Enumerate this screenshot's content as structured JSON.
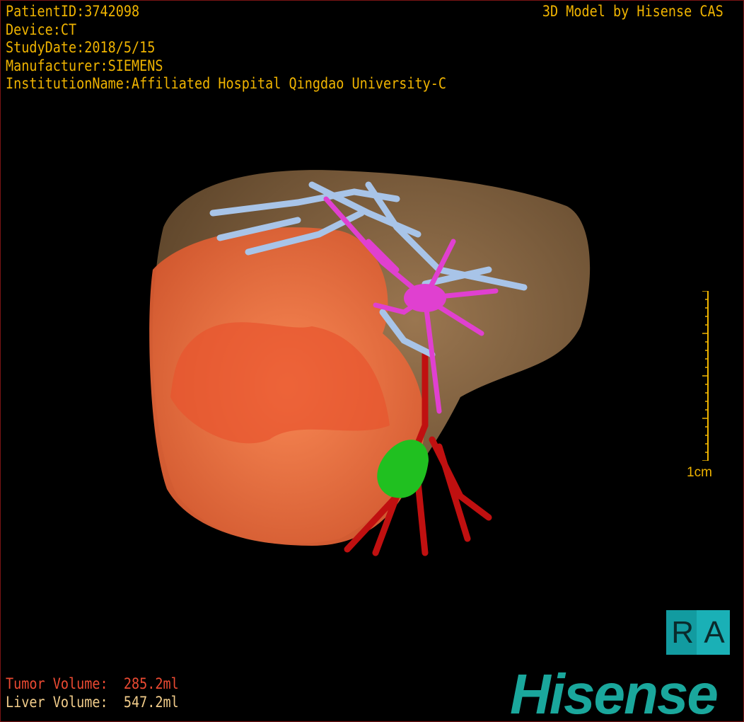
{
  "patient_info": {
    "patient_id": "PatientID:3742098",
    "device": "Device:CT",
    "study_date": "StudyDate:2018/5/15",
    "manufacturer": "Manufacturer:SIEMENS",
    "institution": "InstitutionName:Affiliated Hospital Qingdao University-C"
  },
  "brand_caption": "3D Model by Hisense CAS",
  "scale_bar": {
    "label": "1cm"
  },
  "orientation": {
    "left": "R",
    "right": "A"
  },
  "logo": "Hisense",
  "volumes": {
    "tumor_label": "Tumor Volume:",
    "tumor_value": "285.2ml",
    "liver_label": "Liver Volume:",
    "liver_value": "547.2ml"
  },
  "colors": {
    "overlay_text": "#f0b400",
    "tumor": "#f07040",
    "liver": "#8a6a44",
    "hepatic_vein": "#a8c4e8",
    "portal_vein": "#e040d0",
    "artery": "#c01010",
    "gallbladder": "#20c020",
    "logo": "#1aa79c"
  }
}
